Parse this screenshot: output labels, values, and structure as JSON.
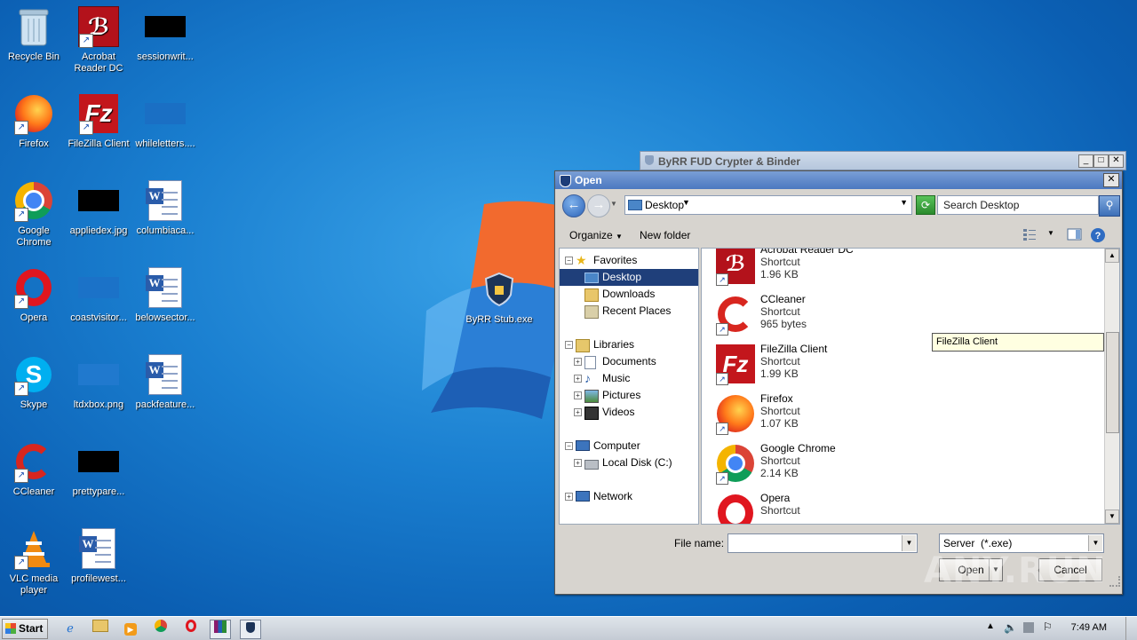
{
  "desktop": {
    "icons": [
      {
        "label": "Recycle Bin"
      },
      {
        "label": "Acrobat Reader DC"
      },
      {
        "label": "sessionwrit..."
      },
      {
        "label": "Firefox"
      },
      {
        "label": "FileZilla Client"
      },
      {
        "label": "whileletters...."
      },
      {
        "label": "Google Chrome"
      },
      {
        "label": "appliedex.jpg"
      },
      {
        "label": "columbiaca..."
      },
      {
        "label": "Opera"
      },
      {
        "label": "coastvisitor..."
      },
      {
        "label": "belowsector..."
      },
      {
        "label": "Skype"
      },
      {
        "label": "ltdxbox.png"
      },
      {
        "label": "packfeature..."
      },
      {
        "label": "CCleaner"
      },
      {
        "label": "prettypare..."
      },
      {
        "label": "VLC media player"
      },
      {
        "label": "profilewest..."
      },
      {
        "label": "ByRR Stub.exe"
      }
    ]
  },
  "background_window": {
    "title": "ByRR FUD Crypter & Binder"
  },
  "dialog": {
    "title": "Open",
    "address": "Desktop",
    "search_placeholder": "Search Desktop",
    "toolbar": {
      "organize": "Organize",
      "new_folder": "New folder"
    },
    "tree": [
      {
        "label": "Favorites"
      },
      {
        "label": "Desktop"
      },
      {
        "label": "Downloads"
      },
      {
        "label": "Recent Places"
      },
      {
        "label": "Libraries"
      },
      {
        "label": "Documents"
      },
      {
        "label": "Music"
      },
      {
        "label": "Pictures"
      },
      {
        "label": "Videos"
      },
      {
        "label": "Computer"
      },
      {
        "label": "Local Disk (C:)"
      },
      {
        "label": "Network"
      }
    ],
    "files": [
      {
        "name": "Acrobat Reader DC",
        "type": "Shortcut",
        "size": "1.96 KB"
      },
      {
        "name": "CCleaner",
        "type": "Shortcut",
        "size": "965 bytes"
      },
      {
        "name": "FileZilla Client",
        "type": "Shortcut",
        "size": "1.99 KB"
      },
      {
        "name": "Firefox",
        "type": "Shortcut",
        "size": "1.07 KB"
      },
      {
        "name": "Google Chrome",
        "type": "Shortcut",
        "size": "2.14 KB"
      },
      {
        "name": "Opera",
        "type": "Shortcut",
        "size": ""
      }
    ],
    "tooltip": "FileZilla Client",
    "file_name_label": "File name:",
    "file_name_value": "",
    "file_type": "Server  (*.exe)",
    "open_button": "Open",
    "cancel_button": "Cancel"
  },
  "taskbar": {
    "start": "Start",
    "time": "7:49 AM"
  },
  "watermark": "ANY.RUN",
  "colors": {
    "selection": "#1f3f7a",
    "tooltip_bg": "#ffffe1"
  }
}
